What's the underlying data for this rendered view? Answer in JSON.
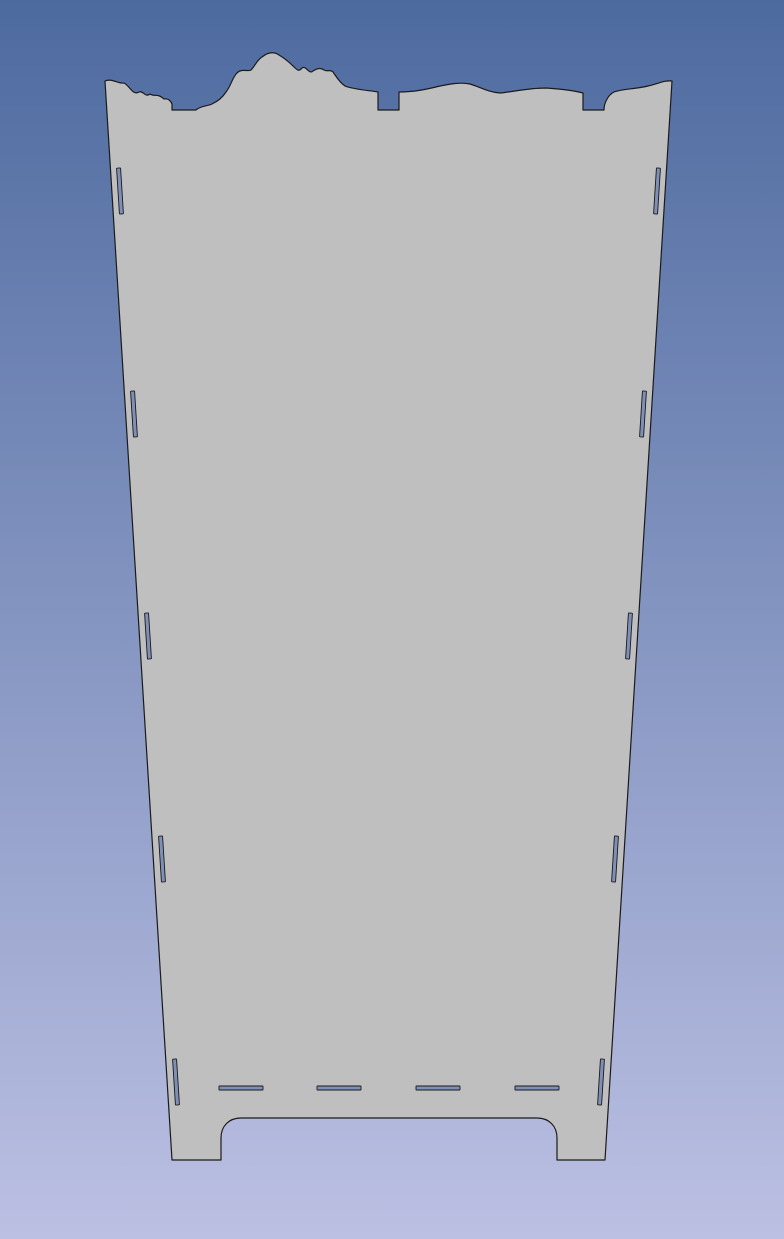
{
  "viewport": {
    "background_top_color": "#4d6a9f",
    "background_bottom_color": "#bcc0e3"
  },
  "part": {
    "fill_color": "#bfbfbf",
    "edge_color": "#1a1a1a",
    "slot_color": "#7f90b8",
    "side_slots_per_edge": 5,
    "bottom_slots": 4
  }
}
